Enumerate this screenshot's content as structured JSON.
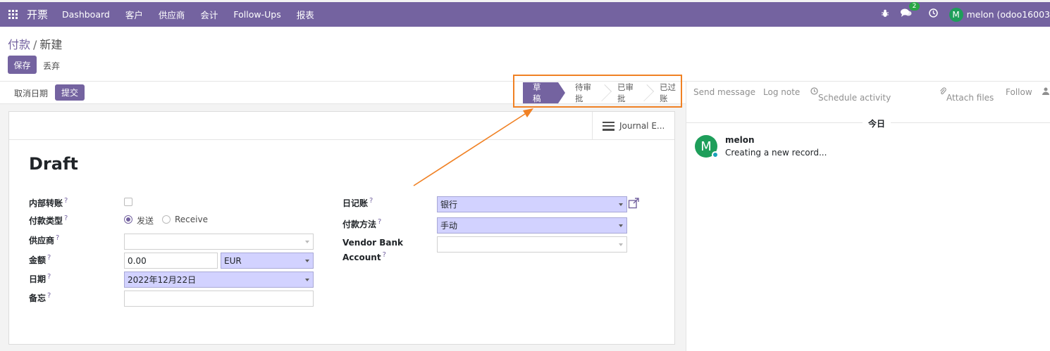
{
  "topbar": {
    "app_name": "开票",
    "menu": [
      "Dashboard",
      "客户",
      "供应商",
      "会计",
      "Follow-Ups",
      "报表"
    ],
    "messages_count": "2",
    "user_initial": "M",
    "user_name": "melon (odoo16003"
  },
  "breadcrumb": {
    "parent": "付款",
    "separator": "/",
    "current": "新建"
  },
  "actions": {
    "save": "保存",
    "discard": "丢弃"
  },
  "statusbar": {
    "cancel_date": "取消日期",
    "submit": "提交",
    "stages": [
      {
        "label": "草稿",
        "active": true
      },
      {
        "label": "待审批",
        "active": false
      },
      {
        "label": "已审批",
        "active": false
      },
      {
        "label": "已过账",
        "active": false
      }
    ]
  },
  "sheet": {
    "smart_button": "Journal E...",
    "title": "Draft",
    "left": {
      "internal_transfer_label": "内部转账",
      "payment_type_label": "付款类型",
      "payment_type_send": "发送",
      "payment_type_receive": "Receive",
      "partner_label": "供应商",
      "amount_label": "金额",
      "amount_value": "0.00",
      "currency_value": "EUR",
      "date_label": "日期",
      "date_value": "2022年12月22日",
      "memo_label": "备忘"
    },
    "right": {
      "journal_label": "日记账",
      "journal_value": "银行",
      "method_label": "付款方法",
      "method_value": "手动",
      "bank_label_line1": "Vendor Bank",
      "bank_label_line2": "Account"
    },
    "help_mark": "?"
  },
  "chatter": {
    "send_message": "Send message",
    "log_note": "Log note",
    "schedule_activity": "Schedule activity",
    "attach_files": "Attach files",
    "follow": "Follow",
    "day_label": "今日",
    "message": {
      "avatar_initial": "M",
      "author": "melon",
      "body": "Creating a new record..."
    }
  },
  "colors": {
    "brand": "#7463a0",
    "required_field": "#d2d2ff",
    "highlight": "#f08124",
    "avatar": "#1e9e5a"
  }
}
